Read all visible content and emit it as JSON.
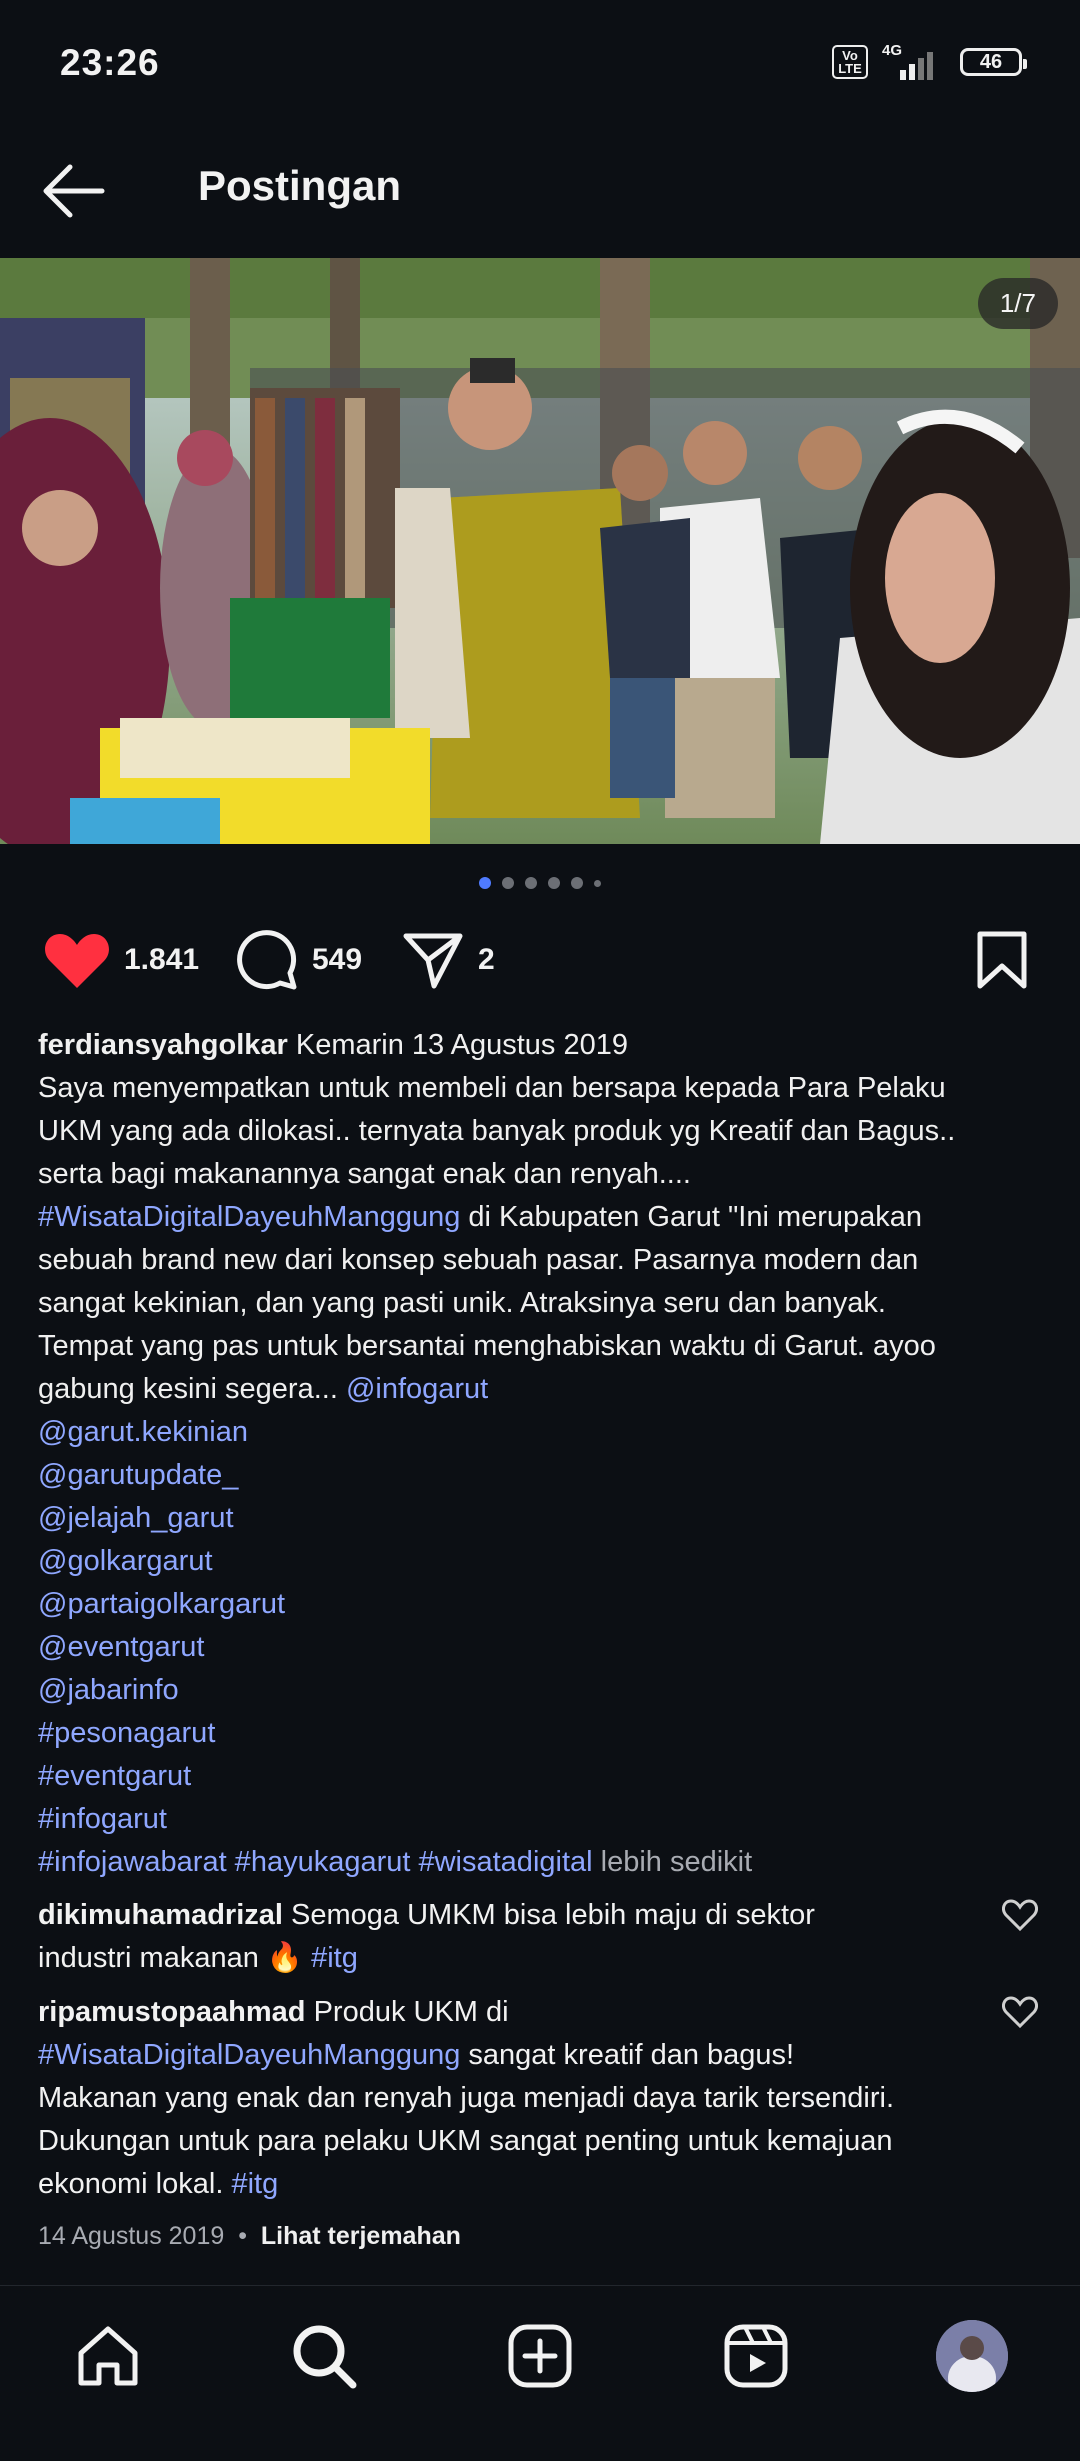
{
  "status": {
    "time": "23:26",
    "volte": "Vo LTE",
    "network": "4G",
    "battery": "46"
  },
  "header": {
    "title": "Postingan"
  },
  "post": {
    "counter": "1/7",
    "likes": "1.841",
    "comments": "549",
    "shares": "2",
    "caption": {
      "username": "ferdiansyahgolkar",
      "date_prefix": "Kemarin 13 Agustus 2019",
      "line1": "Saya menyempatkan untuk membeli dan bersapa kepada Para Pelaku",
      "line2": "UKM yang ada dilokasi.. ternyata banyak produk yg Kreatif dan Bagus..",
      "line3": "serta bagi makanannya sangat enak dan renyah....",
      "hashtag1": "#WisataDigitalDayeuhManggung",
      "line4_rest": " di Kabupaten Garut \"Ini merupakan",
      "line5": "sebuah brand new dari konsep sebuah pasar. Pasarnya modern dan",
      "line6": "sangat kekinian, dan yang pasti unik. Atraksinya seru dan banyak.",
      "line7": "Tempat yang pas untuk bersantai menghabiskan waktu di Garut. ayoo",
      "line8": "gabung kesini segera... ",
      "mention1": "@infogarut",
      "tags": [
        "@garut.kekinian",
        "@garutupdate_",
        "@jelajah_garut",
        "@golkargarut",
        "@partaigolkargarut",
        "@eventgarut",
        "@jabarinfo",
        "#pesonagarut",
        "#eventgarut",
        "#infogarut"
      ],
      "last_tags": "#infojawabarat #hayukagarut #wisatadigital",
      "less": "lebih sedikit"
    },
    "comments_list": [
      {
        "username": "dikimuhamadrizal",
        "text1": "Semoga UMKM bisa lebih maju di sektor",
        "text2": "industri makanan 🔥 ",
        "tag": "#itg"
      },
      {
        "username": "ripamustopaahmad",
        "text1": "Produk UKM di",
        "tag1": "#WisataDigitalDayeuhManggung",
        "text2": " sangat kreatif dan bagus!",
        "text3": "Makanan yang enak dan renyah juga menjadi daya tarik tersendiri.",
        "text4": "Dukungan untuk para pelaku UKM sangat penting untuk kemajuan",
        "text5": "ekonomi lokal. ",
        "tag2": "#itg"
      }
    ],
    "meta": {
      "date": "14 Agustus 2019",
      "separator": "•",
      "translate": "Lihat terjemahan"
    }
  },
  "colors": {
    "accent": "#4f7bff",
    "link": "#8fa7ff",
    "like": "#ff3040",
    "background": "#0c0f14"
  }
}
